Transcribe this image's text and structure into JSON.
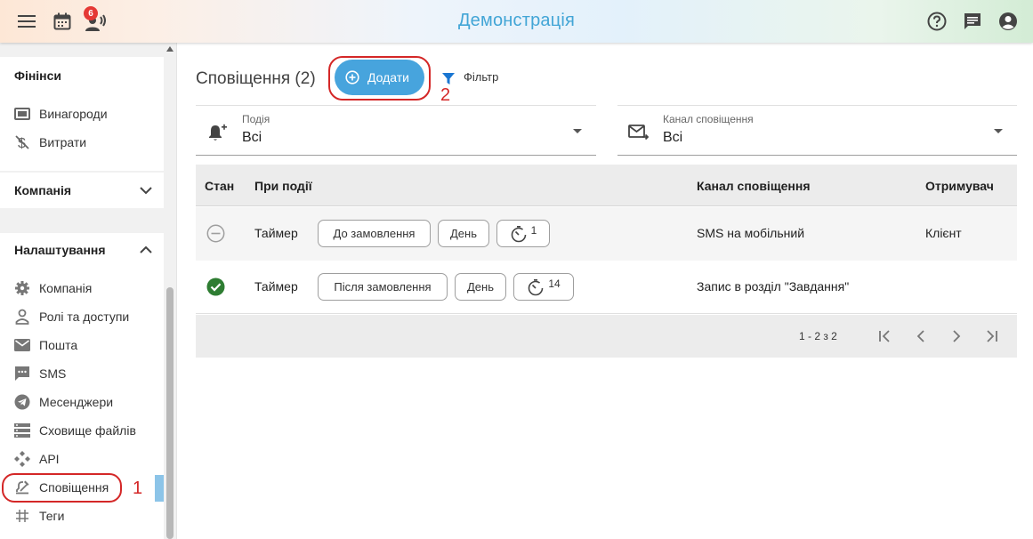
{
  "header": {
    "title": "Демонстрація",
    "notification_count": "6",
    "icons": [
      "menu-icon",
      "calendar-icon",
      "broadcast-person-icon",
      "help-icon",
      "chat-icon",
      "account-icon"
    ]
  },
  "sidebar": {
    "sections": [
      {
        "title": "Фінінси",
        "items": [
          {
            "label": "Винагороди",
            "icon": "money-icon"
          },
          {
            "label": "Витрати",
            "icon": "dollar-strike-icon"
          }
        ]
      },
      {
        "title": "Компанія",
        "collapsed": true
      },
      {
        "title": "Налаштування",
        "expanded": true,
        "items": [
          {
            "label": "Компанія",
            "icon": "gear-icon"
          },
          {
            "label": "Ролі та доступи",
            "icon": "person-icon"
          },
          {
            "label": "Пошта",
            "icon": "mail-icon"
          },
          {
            "label": "SMS",
            "icon": "sms-icon"
          },
          {
            "label": "Месенджери",
            "icon": "telegram-icon"
          },
          {
            "label": "Сховище файлів",
            "icon": "storage-icon"
          },
          {
            "label": "API",
            "icon": "api-icon"
          },
          {
            "label": "Сповіщення",
            "icon": "notification-icon",
            "active": true
          },
          {
            "label": "Теги",
            "icon": "hashtag-icon"
          }
        ]
      }
    ]
  },
  "annotations": [
    "1",
    "2"
  ],
  "main": {
    "title": "Сповіщення (2)",
    "add_label": "Додати",
    "filter_label": "Фільтр",
    "event_filter": {
      "label": "Подія",
      "value": "Всі"
    },
    "channel_filter": {
      "label": "Канал сповіщення",
      "value": "Всі"
    },
    "table": {
      "columns": [
        "Стан",
        "При події",
        "Канал сповіщення",
        "Отримувач"
      ],
      "rows": [
        {
          "status": "disabled",
          "event": "Таймер",
          "when": "До замовлення",
          "unit": "День",
          "count": "1",
          "channel": "SMS на мобільний",
          "recipient": "Клієнт"
        },
        {
          "status": "enabled",
          "event": "Таймер",
          "when": "Після замовлення",
          "unit": "День",
          "count": "14",
          "channel": "Запис в розділ \"Завдання\"",
          "recipient": ""
        }
      ],
      "pagination": "1 - 2 з 2"
    },
    "colors": {
      "accent": "#47a4dd",
      "annotation": "#d42727",
      "enabled": "#2e7d32"
    }
  }
}
